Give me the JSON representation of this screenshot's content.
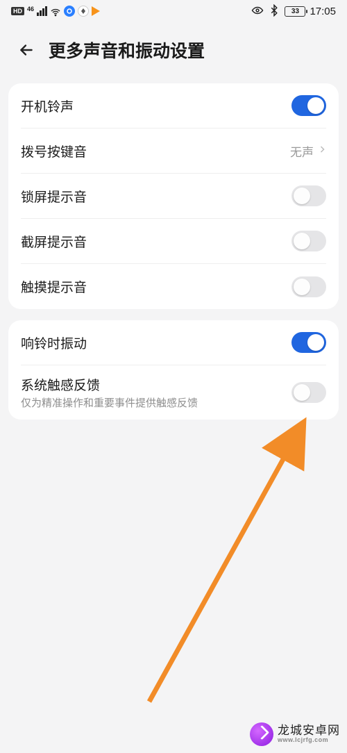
{
  "status": {
    "hd": "HD",
    "net": "46",
    "battery": "33",
    "time": "17:05"
  },
  "header": {
    "title": "更多声音和振动设置"
  },
  "group1": {
    "boot_ring": {
      "label": "开机铃声",
      "on": true
    },
    "dial_tone": {
      "label": "拨号按键音",
      "value": "无声"
    },
    "lock_sound": {
      "label": "锁屏提示音",
      "on": false
    },
    "screenshot_sound": {
      "label": "截屏提示音",
      "on": false
    },
    "touch_sound": {
      "label": "触摸提示音",
      "on": false
    }
  },
  "group2": {
    "vibrate_on_ring": {
      "label": "响铃时振动",
      "on": true
    },
    "haptic": {
      "label": "系统触感反馈",
      "desc": "仅为精准操作和重要事件提供触感反馈",
      "on": false
    }
  },
  "watermark": {
    "name": "龙城安卓网",
    "url": "www.lcjrfg.com"
  }
}
